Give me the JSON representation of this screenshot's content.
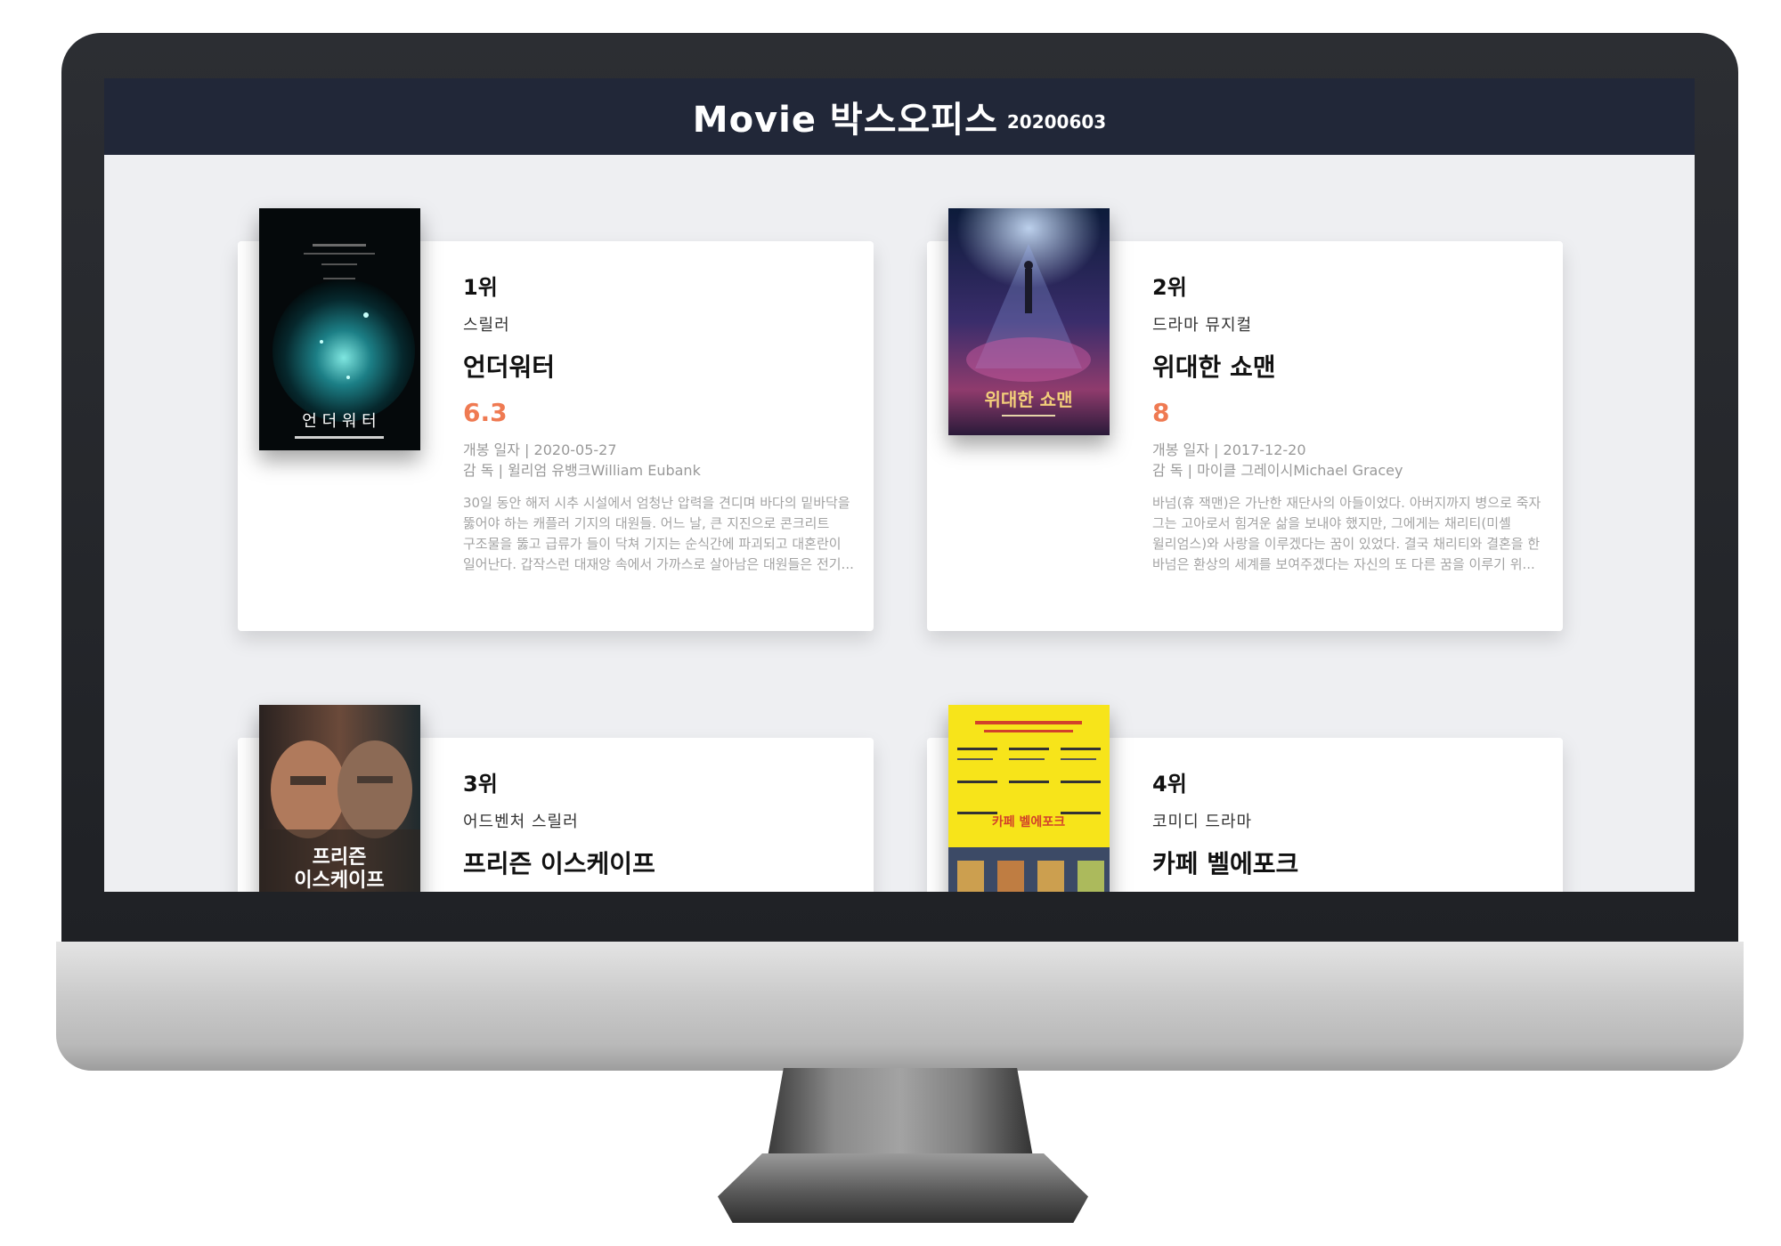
{
  "header": {
    "title": "Movie 박스오피스",
    "date": "20200603"
  },
  "accent_color": "#ef7a52",
  "header_color": "#212738",
  "movies": [
    {
      "rank": "1위",
      "genre": "스릴러",
      "title": "언더워터",
      "rating": "6.3",
      "release": "개봉 일자 | 2020-05-27",
      "director": "감 독 | 윌리엄 유뱅크William Eubank",
      "summary": "30일 동안 해저 시추 시설에서 엄청난 압력을 견디며 바다의 밑바닥을 뚫어야 하는 캐플러 기지의 대원들. 어느 날, 큰 지진으로 콘크리트 구조물을 뚫고 급류가 들이 닥쳐 기지는 순식간에 파괴되고 대혼란이 일어난다. 갑작스런 대재앙 속에서 가까스로 살아남은 대원들은 전기...",
      "poster_text": "언 더 워 터"
    },
    {
      "rank": "2위",
      "genre": "드라마 뮤지컬",
      "title": "위대한 쇼맨",
      "rating": "8",
      "release": "개봉 일자 | 2017-12-20",
      "director": "감 독 | 마이클 그레이시Michael Gracey",
      "summary": "바넘(휴 잭맨)은 가난한 재단사의 아들이었다. 아버지까지 병으로 죽자 그는 고아로서 힘겨운 삶을 보내야 했지만, 그에게는 채리티(미셸 윌리엄스)와 사랑을 이루겠다는 꿈이 있었다. 결국 채리티와 결혼을 한 바넘은 환상의 세계를 보여주겠다는 자신의 또 다른 꿈을 이루기 위...",
      "poster_text": "위대한 쇼맨"
    },
    {
      "rank": "3위",
      "genre": "어드벤처 스릴러",
      "title": "프리즌 이스케이프",
      "poster_text_1": "프리즌",
      "poster_text_2": "이스케이프"
    },
    {
      "rank": "4위",
      "genre": "코미디 드라마",
      "title": "카페 벨에포크",
      "poster_text": "카페 벨에포크"
    }
  ]
}
